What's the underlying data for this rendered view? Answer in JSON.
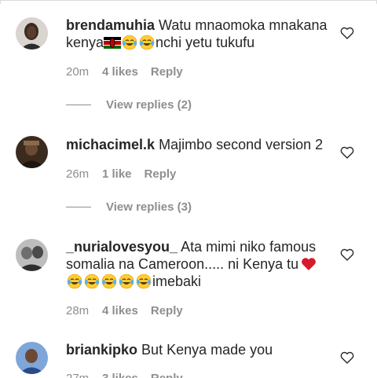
{
  "comments": [
    {
      "username": "brendamuhia",
      "text_part1": "Watu mnaomoka mnakana kenya",
      "text_part2": "nchi yetu tukufu",
      "age": "20m",
      "likes": "4 likes",
      "reply": "Reply",
      "view_replies": "View replies (2)"
    },
    {
      "username": "michacimel.k",
      "text_part1": "Majimbo second version 2",
      "age": "26m",
      "likes": "1 like",
      "reply": "Reply",
      "view_replies": "View replies (3)"
    },
    {
      "username": "_nurialovesyou_",
      "text_part1": "Ata mimi niko famous somalia na Cameroon..... ni Kenya tu",
      "text_part2": "imebaki",
      "age": "28m",
      "likes": "4 likes",
      "reply": "Reply"
    },
    {
      "username": "briankipko",
      "text_part1": "But Kenya made you",
      "age": "27m",
      "likes": "3 likes",
      "reply": "Reply"
    }
  ],
  "icons": {
    "like": "heart-outline-icon",
    "flag": "kenya-flag-emoji",
    "laugh": "tears-of-joy-emoji",
    "love": "red-heart-emoji"
  },
  "colors": {
    "text": "#262626",
    "muted": "#8e8e8e",
    "heart_red": "#e0245e"
  }
}
